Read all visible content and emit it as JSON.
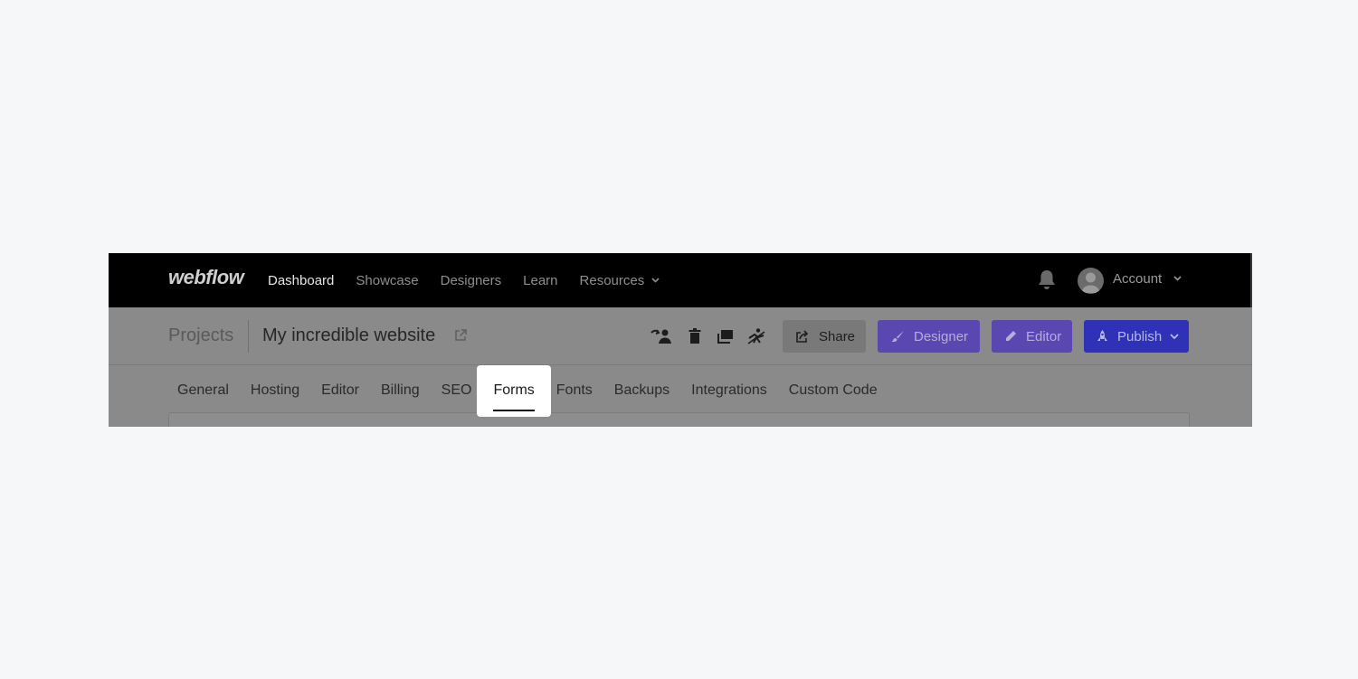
{
  "nav": {
    "logo": "webflow",
    "links": [
      "Dashboard",
      "Showcase",
      "Designers",
      "Learn",
      "Resources"
    ],
    "account_label": "Account",
    "icons": [
      "bell-icon",
      "avatar",
      "chevron-down-icon"
    ]
  },
  "project": {
    "breadcrumb_root": "Projects",
    "site_name": "My incredible website",
    "actions": {
      "share": "Share",
      "designer": "Designer",
      "editor": "Editor",
      "publish": "Publish"
    },
    "icon_buttons": [
      "transfer-user-icon",
      "trash-icon",
      "duplicate-icon",
      "archive-icon"
    ]
  },
  "tabs": {
    "items": [
      "General",
      "Hosting",
      "Editor",
      "Billing",
      "SEO",
      "Forms",
      "Fonts",
      "Backups",
      "Integrations",
      "Custom Code"
    ],
    "active": "Forms"
  },
  "colors": {
    "nav_bg": "#000000",
    "designer": "#5b47b0",
    "editor": "#5b47b0",
    "publish": "#2f31b6",
    "page_bg": "#f6f7f8"
  }
}
